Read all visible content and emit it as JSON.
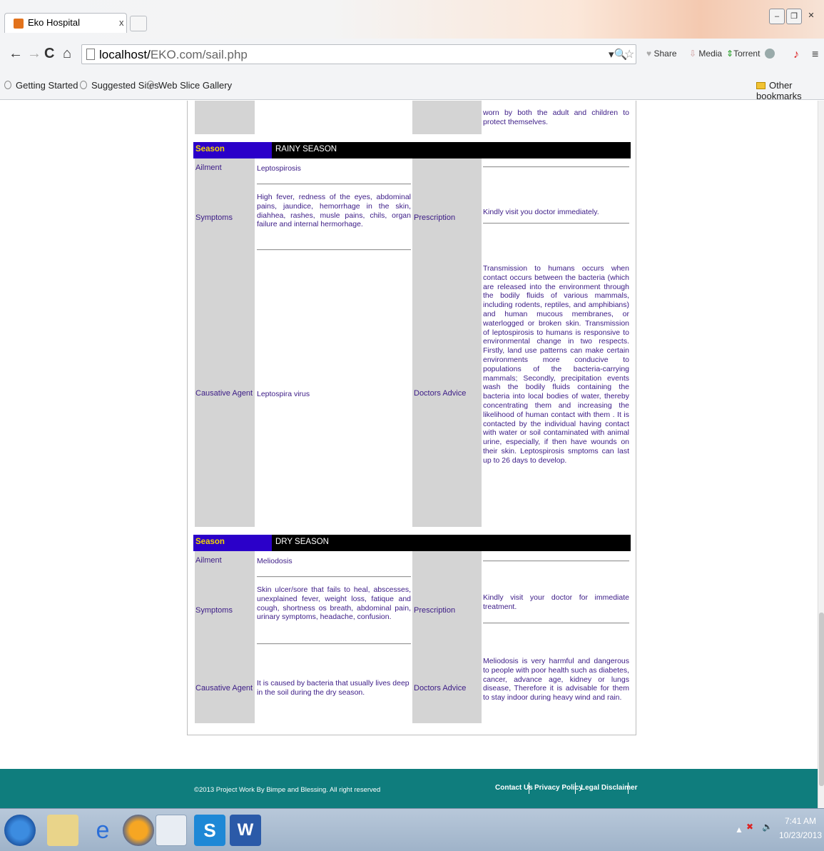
{
  "browser": {
    "tab_title": "Eko Hospital",
    "tab_close": "x",
    "url_host": "localhost/",
    "url_path": "EKO.com/sail.php",
    "toolbar": {
      "share": "Share",
      "media": "Media",
      "torrent": "Torrent"
    },
    "bookmarks": [
      "Getting Started",
      "Suggested Sites",
      "Web Slice Gallery"
    ],
    "other_bookmarks": "Other bookmarks"
  },
  "top_fragment": "worn by both the adult and children to protect themselves.",
  "sections": [
    {
      "season_label": "Season",
      "season_value": "RAINY SEASON",
      "ailment_label": "Ailment",
      "ailment": "Leptospirosis",
      "symptoms_label": "Symptoms",
      "symptoms": "High fever, redness of the eyes, abdominal pains, jaundice, hemorrhage in the skin, diahhea, rashes, musle pains, chils, organ failure and internal hermorhage.",
      "prescription_label": "Prescription",
      "prescription": "Kindly visit you doctor immediately.",
      "agent_label": "Causative Agent",
      "agent": "Leptospira virus",
      "advice_label": "Doctors Advice",
      "advice": "Transmission to humans occurs when contact occurs between the bacteria (which are released into the environment through the bodily fluids of various mammals, including rodents, reptiles, and amphibians) and human mucous membranes, or waterlogged or broken skin. Transmission of leptospirosis to humans is responsive to environmental change in two respects. Firstly, land use patterns can make certain environments more conducive to populations of the bacteria-carrying mammals; Secondly, precipitation events wash the bodily fluids containing the bacteria into local bodies of water, thereby concentrating them and increasing the likelihood of human contact with them . It is contacted by the individual having contact with water or soil contaminated with animal urine, especially, if then have wounds on their skin. Leptospirosis smptoms can last up to 26 days to develop."
    },
    {
      "season_label": "Season",
      "season_value": "DRY SEASON",
      "ailment_label": "Ailment",
      "ailment": "Meliodosis",
      "symptoms_label": "Symptoms",
      "symptoms": "Skin ulcer/sore that fails to heal, abscesses, unexplained fever, weight loss, fatique and cough, shortness os breath, abdominal pain, urinary symptoms, headache, confusion.",
      "prescription_label": "Prescription",
      "prescription": "Kindly visit your doctor for immediate treatment.",
      "agent_label": "Causative Agent",
      "agent": "It is caused by bacteria that usually lives deep in the soil during the dry season.",
      "advice_label": "Doctors Advice",
      "advice": "Meliodosis is very harmful and dangerous to people with poor health such as diabetes, cancer, advance age, kidney or lungs disease, Therefore it is advisable for them to stay indoor during heavy wind and rain."
    }
  ],
  "footer": {
    "copyright": "©2013 Project Work By Bimpe and Blessing. All right reserved",
    "links": [
      "Contact Us",
      "Privacy Policy",
      "Legal Disclaimer"
    ]
  },
  "taskbar": {
    "time": "7:41 AM",
    "date": "10/23/2013"
  }
}
